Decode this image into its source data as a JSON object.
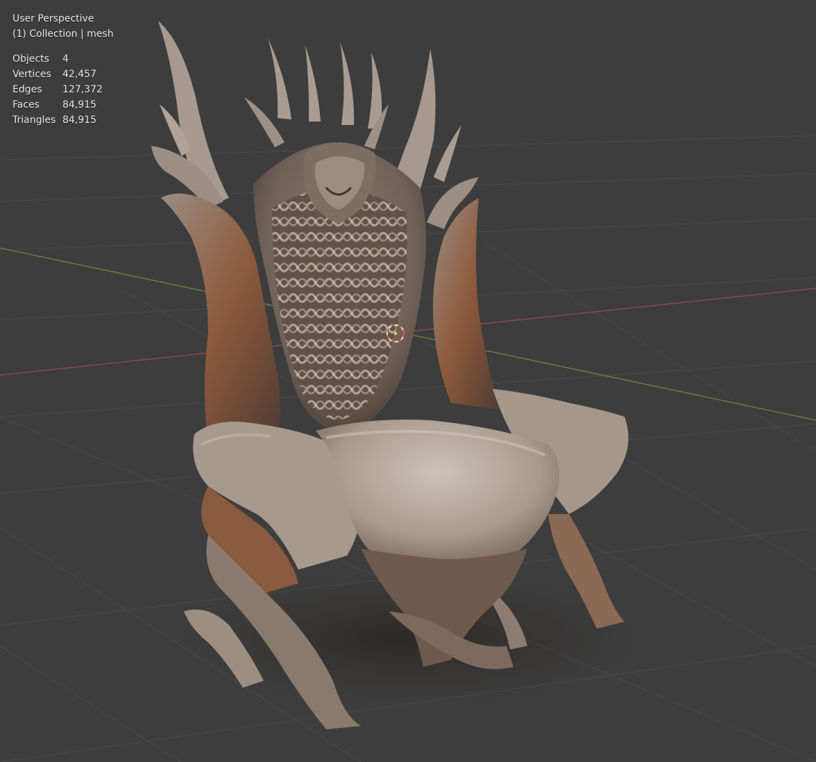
{
  "viewport": {
    "view_name": "User Perspective",
    "collection_label": "(1) Collection | mesh"
  },
  "stats": [
    {
      "label": "Objects",
      "value": "4"
    },
    {
      "label": "Vertices",
      "value": "42,457"
    },
    {
      "label": "Edges",
      "value": "127,372"
    },
    {
      "label": "Faces",
      "value": "84,915"
    },
    {
      "label": "Triangles",
      "value": "84,915"
    }
  ],
  "colors": {
    "background": "#3d3d3d",
    "grid": "#4a4a4a",
    "x_axis": "#a04a52",
    "y_axis": "#6a8a3a",
    "mesh_light": "#b8aa9c",
    "mesh_shadow": "#3e322b",
    "mesh_rust": "#8a4a2a",
    "cursor": "#e0462e"
  },
  "scene": {
    "object": "throne-mesh",
    "cursor_icon": "3d-cursor-icon"
  }
}
